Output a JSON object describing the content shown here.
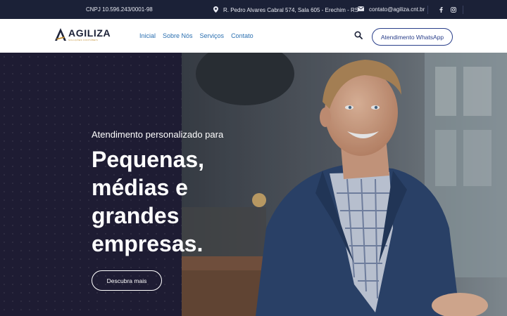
{
  "topbar": {
    "cnpj": "CNPJ 10.596.243/0001-98",
    "address": "R. Pedro Alvares Cabral 574, Sala 605 - Erechim - RS",
    "email": "contato@agiliza.cnt.br",
    "icons": [
      "map-pin-icon",
      "envelope-icon",
      "facebook-icon",
      "instagram-icon"
    ]
  },
  "brand": {
    "name": "AGILIZA",
    "tagline": "SOLUÇÕES CONTÁBEIS"
  },
  "nav": {
    "items": [
      {
        "label": "Inicial"
      },
      {
        "label": "Sobre Nós"
      },
      {
        "label": "Serviços"
      },
      {
        "label": "Contato"
      }
    ],
    "whatsapp_label": "Atendimento WhatsApp"
  },
  "hero": {
    "subtitle": "Atendimento personalizado para",
    "title": "Pequenas, médias e grandes empresas.",
    "cta_label": "Descubra mais"
  },
  "colors": {
    "topbar_bg": "#1b2137",
    "hero_left_bg": "#1e1c33",
    "nav_link": "#2a6fb0",
    "button_border": "#2a3f8a",
    "logo_accent": "#c08a2a"
  }
}
